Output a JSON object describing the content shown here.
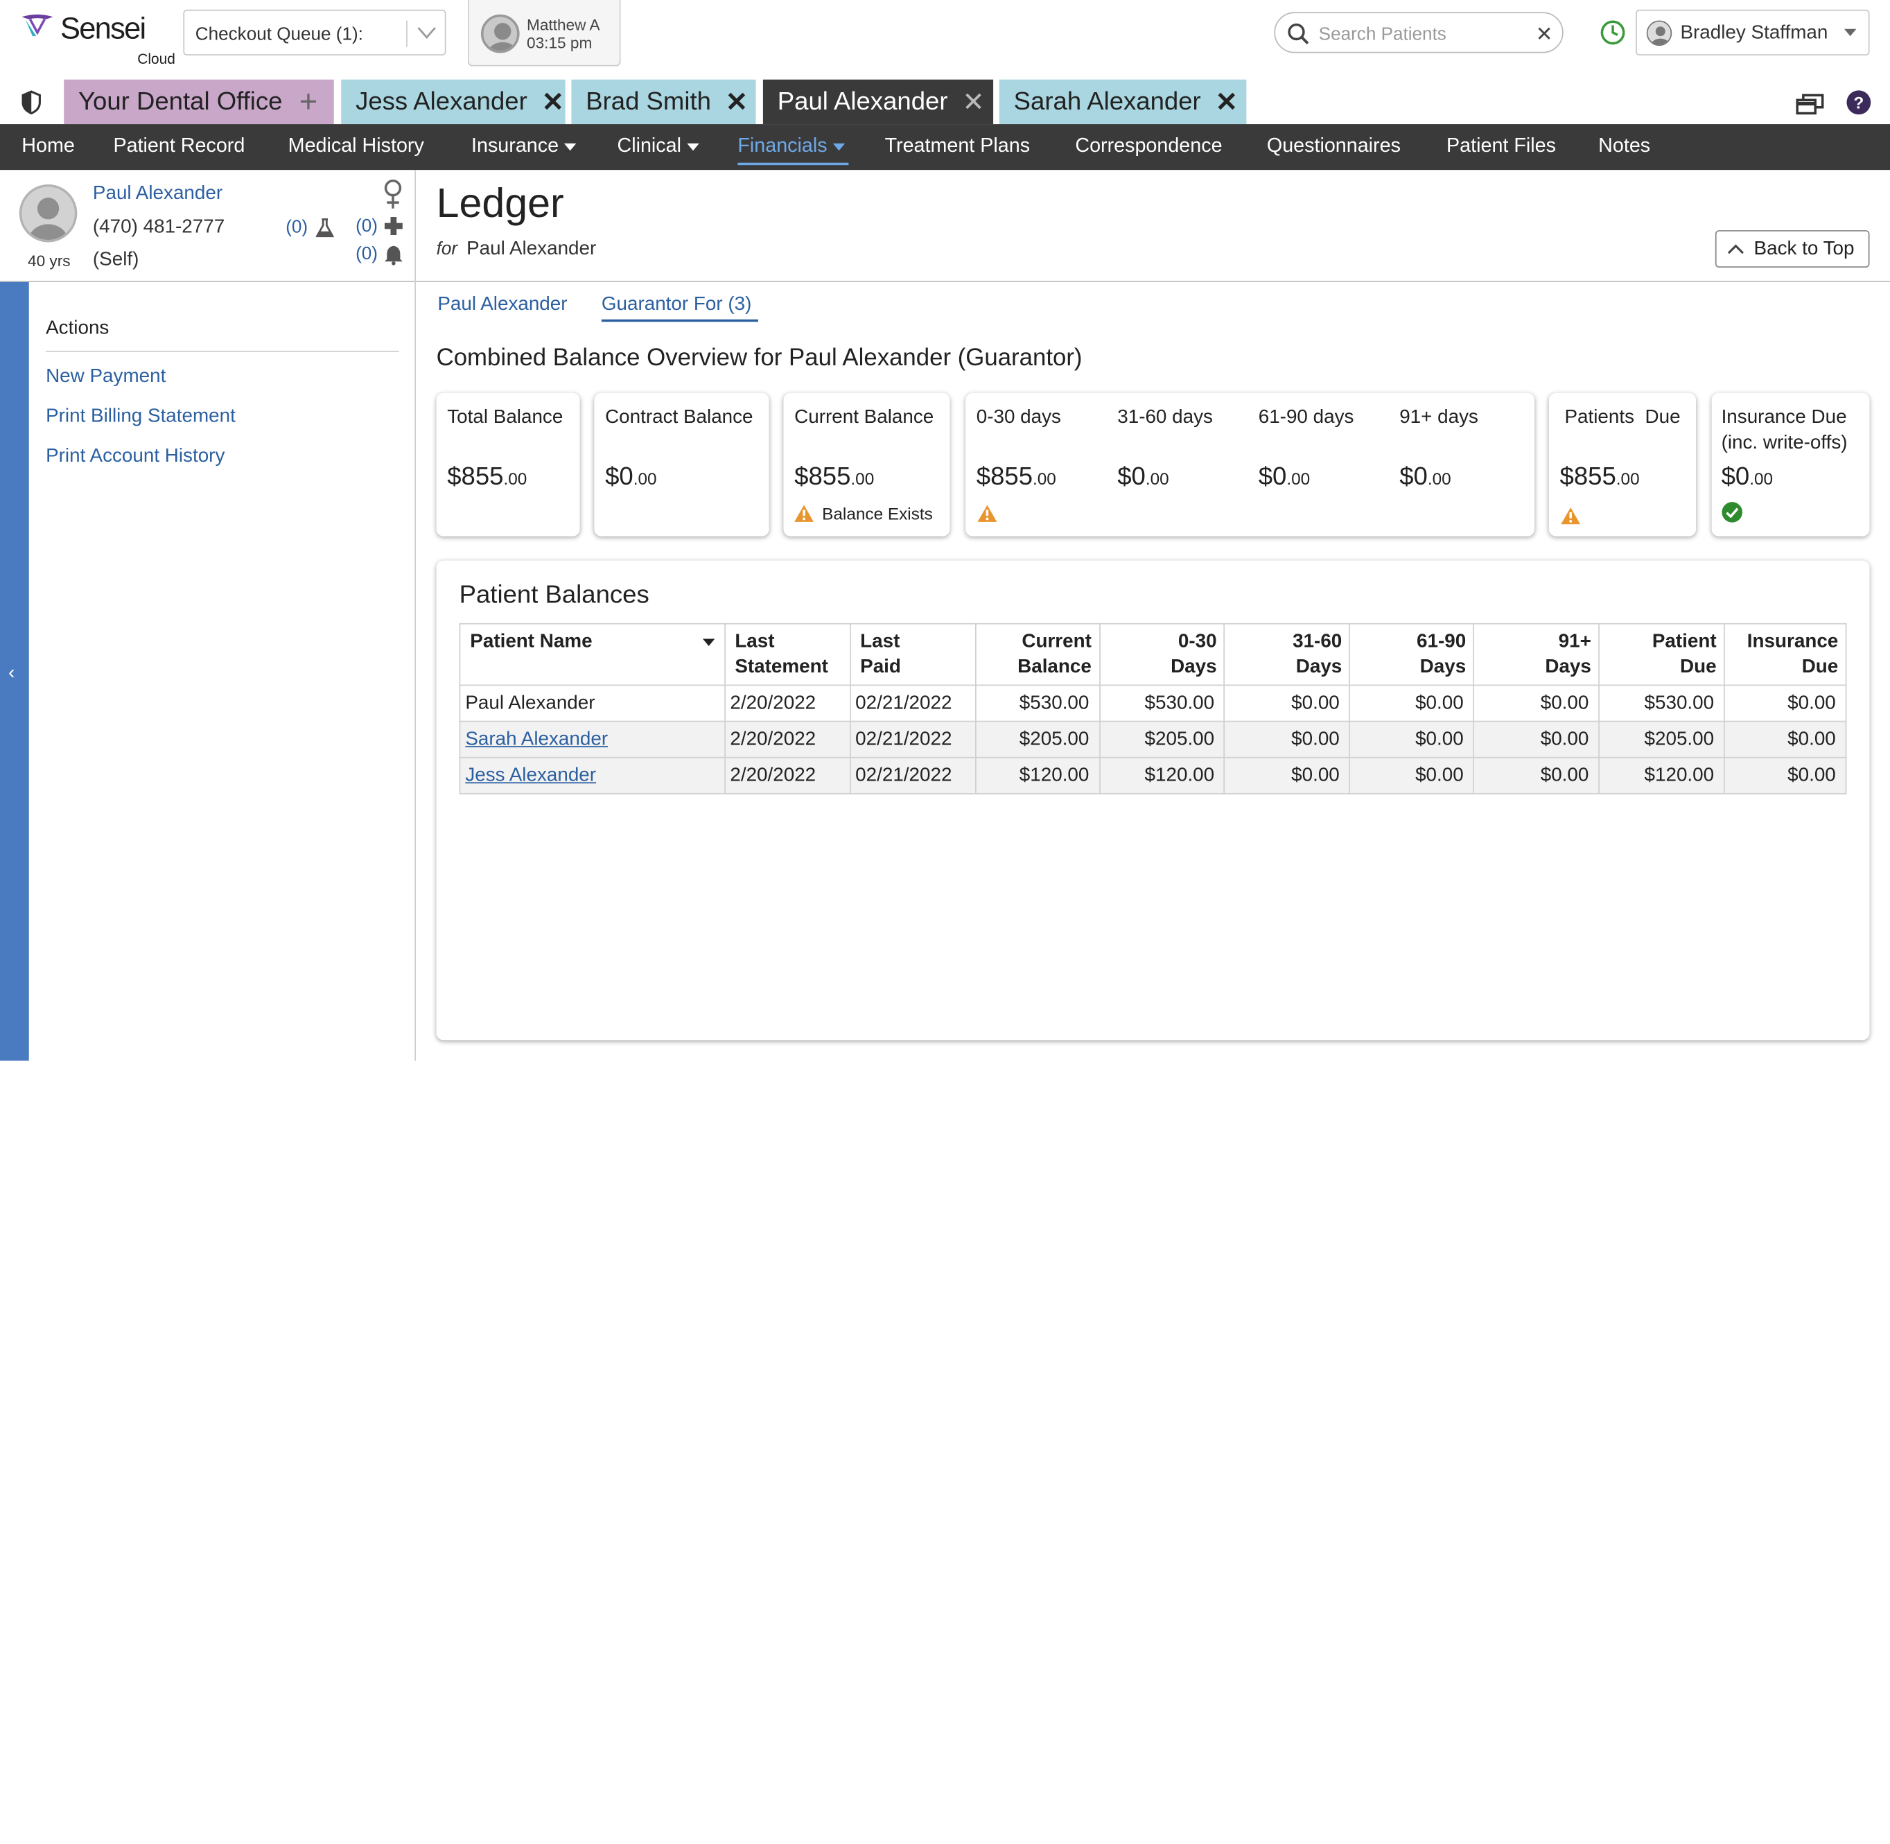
{
  "app": {
    "brand": "Sensei",
    "brand_sub": "Cloud"
  },
  "topbar": {
    "queue_label": "Checkout Queue (1):",
    "provider_name": "Matthew A",
    "provider_time": "03:15 pm",
    "search_placeholder": "Search Patients",
    "user_name": "Bradley Staffman"
  },
  "tabs": [
    {
      "label": "Your Dental Office",
      "close": "+"
    },
    {
      "label": "Jess Alexander",
      "close": "✕"
    },
    {
      "label": "Brad Smith",
      "close": "✕"
    },
    {
      "label": "Paul Alexander",
      "close": "✕"
    },
    {
      "label": "Sarah Alexander",
      "close": "✕"
    }
  ],
  "nav": [
    "Home",
    "Patient Record",
    "Medical History",
    "Insurance",
    "Clinical",
    "Financials",
    "Treatment Plans",
    "Correspondence",
    "Questionnaires",
    "Patient Files",
    "Notes"
  ],
  "patient": {
    "name": "Paul Alexander",
    "phone": "(470) 481-2777",
    "relation": "(Self)",
    "age": "40 yrs",
    "lab_count": "(0)",
    "medical_count": "(0)",
    "alert_count": "(0)"
  },
  "sidebar": {
    "title": "Actions",
    "links": [
      "New Payment",
      "Print Billing Statement",
      "Print Account History"
    ]
  },
  "ledger": {
    "title": "Ledger",
    "for_label": "for",
    "for_name": "Paul Alexander",
    "back_to_top": "Back to Top",
    "subtabs": [
      "Paul Alexander",
      "Guarantor For (3)"
    ],
    "overview_title": "Combined Balance Overview for Paul Alexander (Guarantor)"
  },
  "cards": {
    "total": {
      "label": "Total Balance",
      "whole": "$855",
      "cents": ".00"
    },
    "contract": {
      "label": "Contract Balance",
      "whole": "$0",
      "cents": ".00"
    },
    "current": {
      "label": "Current Balance",
      "whole": "$855",
      "cents": ".00",
      "note": "Balance Exists"
    },
    "aging": [
      {
        "label": "0-30 days",
        "whole": "$855",
        "cents": ".00"
      },
      {
        "label": "31-60 days",
        "whole": "$0",
        "cents": ".00"
      },
      {
        "label": "61-90 days",
        "whole": "$0",
        "cents": ".00"
      },
      {
        "label": "91+ days",
        "whole": "$0",
        "cents": ".00"
      }
    ],
    "patients_due": {
      "label": "Patients  Due",
      "whole": "$855",
      "cents": ".00"
    },
    "insurance_due": {
      "label_1": "Insurance Due",
      "label_2": "(inc. write-offs)",
      "whole": "$0",
      "cents": ".00"
    }
  },
  "colors": {
    "d0_30": "#2e8b2e",
    "d31_60": "#e8b400",
    "d61_90": "#e08a1e",
    "d91": "#c62828",
    "link": "#2b5fa0",
    "nav_bg": "#3a3a3a"
  },
  "balances": {
    "title": "Patient Balances",
    "headers": [
      [
        "Patient Name",
        ""
      ],
      [
        "Last",
        "Statement"
      ],
      [
        "Last",
        "Paid"
      ],
      [
        "Current",
        "Balance"
      ],
      [
        "0-30",
        "Days"
      ],
      [
        "31-60",
        "Days"
      ],
      [
        "61-90",
        "Days"
      ],
      [
        "91+",
        "Days"
      ],
      [
        "Patient",
        "Due"
      ],
      [
        "Insurance",
        "Due"
      ]
    ],
    "rows": [
      [
        "Paul Alexander",
        "2/20/2022",
        "02/21/2022",
        "$530.00",
        "$530.00",
        "$0.00",
        "$0.00",
        "$0.00",
        "$530.00",
        "$0.00"
      ],
      [
        "Sarah Alexander",
        "2/20/2022",
        "02/21/2022",
        "$205.00",
        "$205.00",
        "$0.00",
        "$0.00",
        "$0.00",
        "$205.00",
        "$0.00"
      ],
      [
        "Jess Alexander",
        "2/20/2022",
        "02/21/2022",
        "$120.00",
        "$120.00",
        "$0.00",
        "$0.00",
        "$0.00",
        "$120.00",
        "$0.00"
      ]
    ]
  }
}
